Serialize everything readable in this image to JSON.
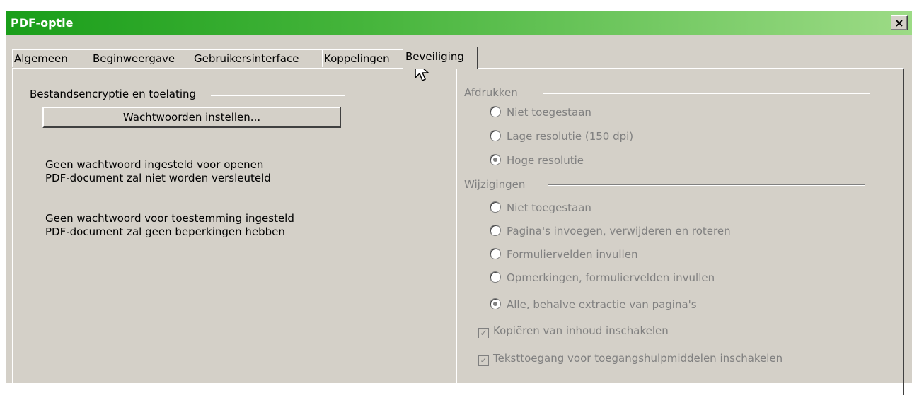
{
  "window": {
    "title": "PDF-optie",
    "close_glyph": "×"
  },
  "tabs": [
    "Algemeen",
    "Beginweergave",
    "Gebruikersinterface",
    "Koppelingen",
    "Beveiliging"
  ],
  "active_tab": "Beveiliging",
  "encryption": {
    "group_label": "Bestandsencryptie en toelating",
    "button_label": "Wachtwoorden instellen...",
    "status_open_1": "Geen wachtwoord ingesteld voor openen",
    "status_open_2": "PDF-document zal niet worden versleuteld",
    "status_perm_1": "Geen wachtwoord voor toestemming ingesteld",
    "status_perm_2": "PDF-document zal geen beperkingen hebben"
  },
  "printing": {
    "group_label": "Afdrukken",
    "options": [
      "Niet toegestaan",
      "Lage resolutie (150 dpi)",
      "Hoge resolutie"
    ],
    "selected": "Hoge resolutie"
  },
  "changes": {
    "group_label": "Wijzigingen",
    "options": [
      "Niet toegestaan",
      "Pagina's invoegen, verwijderen en roteren",
      "Formuliervelden invullen",
      "Opmerkingen, formuliervelden invullen",
      "Alle, behalve extractie van pagina's"
    ],
    "selected": "Alle, behalve extractie van pagina's"
  },
  "checkboxes": {
    "copy_label": "Kopiëren van inhoud inschakelen",
    "copy_checked": true,
    "access_label": "Teksttoegang voor toegangshulpmiddelen inschakelen",
    "access_checked": true
  }
}
